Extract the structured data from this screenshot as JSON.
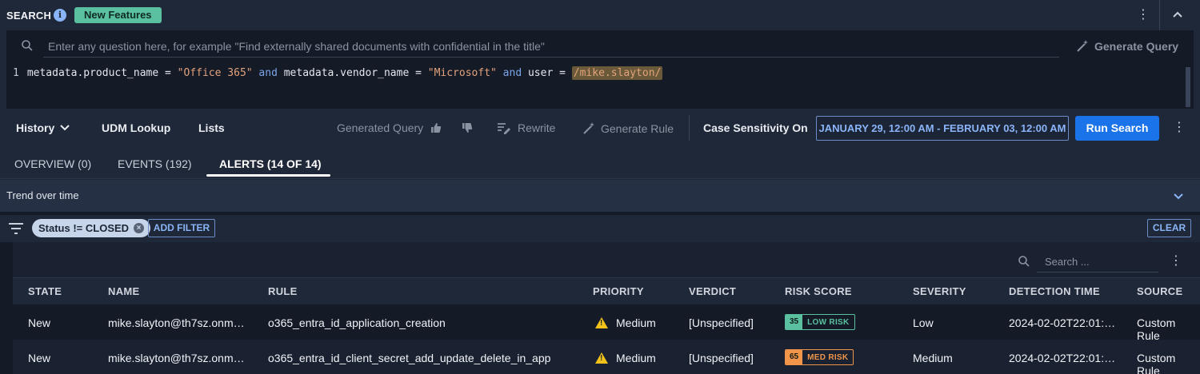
{
  "header": {
    "title": "SEARCH",
    "info_icon": "info-icon",
    "badge": "New Features"
  },
  "query": {
    "nl_placeholder": "Enter any question here, for example \"Find externally shared documents with confidential in the title\"",
    "generate_query_label": "Generate Query",
    "line_number": "1",
    "tokens": {
      "t1": "metadata.product_name = ",
      "t2": "\"Office 365\"",
      "t3": " and ",
      "t4": "metadata.vendor_name = ",
      "t5": "\"Microsoft\"",
      "t6": " and ",
      "t7": "user = ",
      "t8": "/mike.slayton/"
    }
  },
  "toolbar": {
    "history": "History",
    "udm_lookup": "UDM Lookup",
    "lists": "Lists",
    "generated_query": "Generated Query",
    "rewrite": "Rewrite",
    "generate_rule": "Generate Rule",
    "case_sensitivity": "Case Sensitivity On",
    "date_range": "JANUARY 29, 12:00 AM - FEBRUARY 03, 12:00 AM",
    "run_search": "Run Search"
  },
  "tabs": [
    {
      "label": "OVERVIEW (0)",
      "active": false
    },
    {
      "label": "EVENTS (192)",
      "active": false
    },
    {
      "label": "ALERTS (14 OF 14)",
      "active": true
    }
  ],
  "trend": {
    "label": "Trend over time"
  },
  "filters": {
    "chip": "Status != CLOSED",
    "add_filter": "ADD FILTER",
    "clear": "CLEAR"
  },
  "table": {
    "search_placeholder": "Search ...",
    "columns": [
      "STATE",
      "NAME",
      "RULE",
      "PRIORITY",
      "VERDICT",
      "RISK SCORE",
      "SEVERITY",
      "DETECTION TIME",
      "SOURCE"
    ],
    "rows": [
      {
        "state": "New",
        "name": "mike.slayton@th7sz.onm…",
        "rule": "o365_entra_id_application_creation",
        "priority": "Medium",
        "verdict": "[Unspecified]",
        "risk_score": "35",
        "risk_label": "LOW RISK",
        "risk_color": "#5bc0a0",
        "severity": "Low",
        "detection_time": "2024-02-02T22:01:…",
        "source": "Custom Rule"
      },
      {
        "state": "New",
        "name": "mike.slayton@th7sz.onm…",
        "rule": "o365_entra_id_client_secret_add_update_delete_in_app",
        "priority": "Medium",
        "verdict": "[Unspecified]",
        "risk_score": "65",
        "risk_label": "MED RISK",
        "risk_color": "#f0954a",
        "severity": "Medium",
        "detection_time": "2024-02-02T22:01:…",
        "source": "Custom Rule"
      }
    ]
  },
  "colors": {
    "accent": "#1a73e8",
    "link": "#8ab4f8",
    "warning": "#f2c21a"
  }
}
